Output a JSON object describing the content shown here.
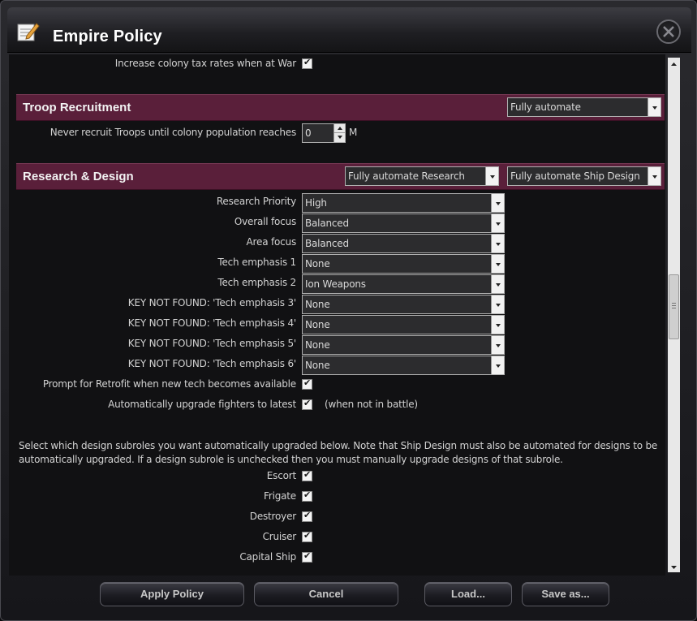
{
  "window": {
    "title": "Empire Policy"
  },
  "top_option": {
    "label": "Increase colony tax rates when at War",
    "checked": true
  },
  "troop": {
    "title": "Troop Recruitment",
    "mode": "Fully automate",
    "pop_label": "Never recruit Troops until colony population reaches",
    "pop_value": "0",
    "pop_unit": "M"
  },
  "research": {
    "title": "Research & Design",
    "research_mode": "Fully automate Research",
    "design_mode": "Fully automate Ship Design",
    "rows": [
      {
        "label": "Research Priority",
        "value": "High"
      },
      {
        "label": "Overall focus",
        "value": "Balanced"
      },
      {
        "label": "Area focus",
        "value": "Balanced"
      },
      {
        "label": "Tech emphasis 1",
        "value": "None"
      },
      {
        "label": "Tech emphasis 2",
        "value": "Ion Weapons"
      },
      {
        "label": "KEY NOT FOUND: 'Tech emphasis 3'",
        "value": "None"
      },
      {
        "label": "KEY NOT FOUND: 'Tech emphasis 4'",
        "value": "None"
      },
      {
        "label": "KEY NOT FOUND: 'Tech emphasis 5'",
        "value": "None"
      },
      {
        "label": "KEY NOT FOUND: 'Tech emphasis 6'",
        "value": "None"
      }
    ],
    "retrofit_label": "Prompt for Retrofit when new tech becomes available",
    "fighters_label": "Automatically upgrade fighters to latest",
    "fighters_note": "(when not in battle)"
  },
  "subroles": {
    "description": "Select which design subroles you want automatically upgraded below. Note that Ship Design must also be automated for designs to be automatically upgraded. If a design subrole is unchecked then you must manually upgrade designs of that subrole.",
    "items": [
      {
        "label": "Escort",
        "checked": true
      },
      {
        "label": "Frigate",
        "checked": true
      },
      {
        "label": "Destroyer",
        "checked": true
      },
      {
        "label": "Cruiser",
        "checked": true
      },
      {
        "label": "Capital Ship",
        "checked": true
      }
    ]
  },
  "buttons": {
    "apply": "Apply Policy",
    "cancel": "Cancel",
    "load": "Load...",
    "save_as": "Save as..."
  },
  "colors": {
    "section_bg": "#5a1f3a",
    "window_bg": "#111113"
  },
  "icons": {
    "title": "notepad-pencil-icon",
    "close": "close-icon"
  }
}
